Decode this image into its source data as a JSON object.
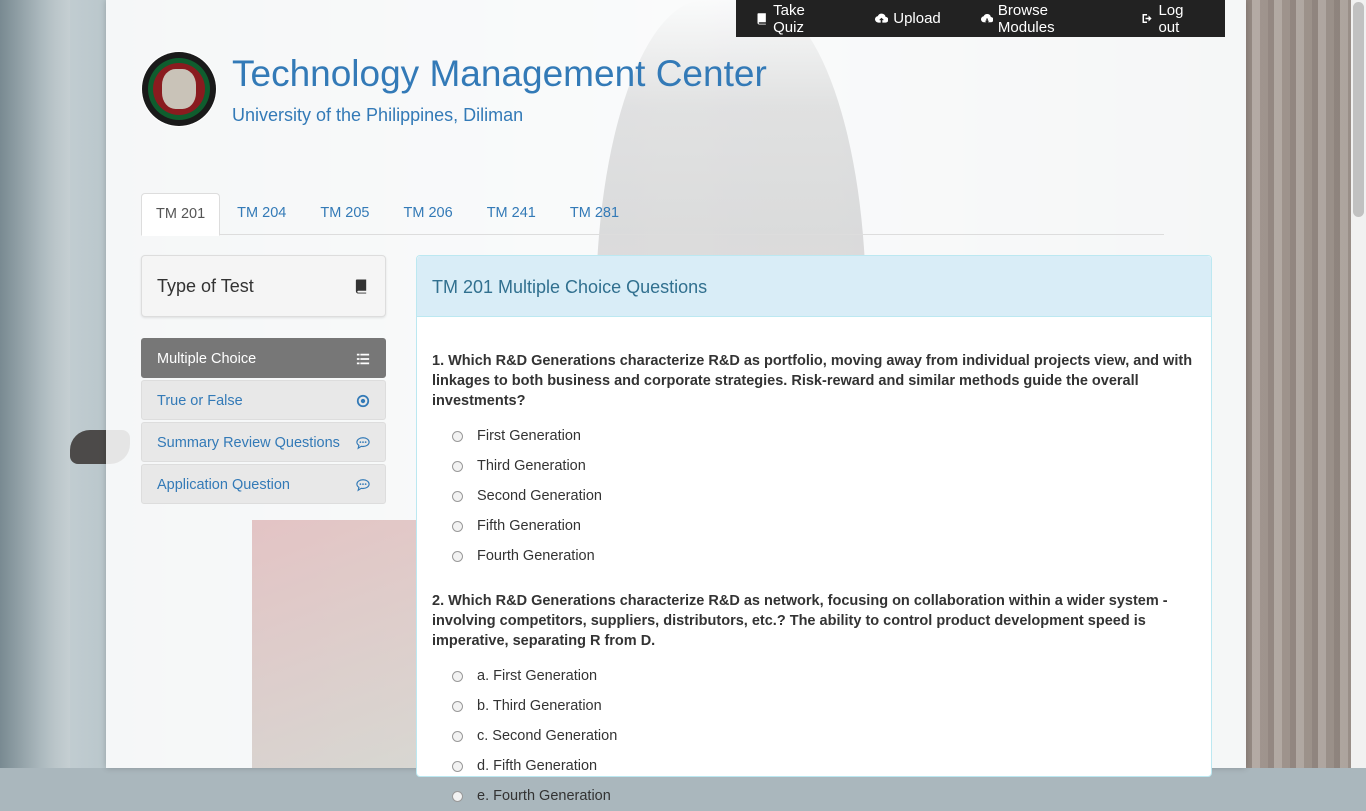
{
  "topnav": [
    {
      "label": "Take Quiz",
      "icon": "book-icon"
    },
    {
      "label": "Upload",
      "icon": "cloud-upload-icon"
    },
    {
      "label": "Browse Modules",
      "icon": "cloud-download-icon"
    },
    {
      "label": "Log out",
      "icon": "logout-icon"
    }
  ],
  "header": {
    "title": "Technology Management Center",
    "subtitle": "University of the Philippines, Diliman",
    "logo_icon": "tmc-seal-logo"
  },
  "tabs": [
    "TM 201",
    "TM 204",
    "TM 205",
    "TM 206",
    "TM 241",
    "TM 281"
  ],
  "active_tab": "TM 201",
  "sidebar": {
    "heading": "Type of Test",
    "heading_icon": "book-icon",
    "items": [
      {
        "label": "Multiple Choice",
        "icon": "list-icon",
        "active": true
      },
      {
        "label": "True or False",
        "icon": "radio-dot-icon"
      },
      {
        "label": "Summary Review Questions",
        "icon": "comment-icon"
      },
      {
        "label": "Application Question",
        "icon": "comment-icon"
      }
    ]
  },
  "panel": {
    "title": "TM 201 Multiple Choice Questions",
    "questions": [
      {
        "text": "1. Which R&D Generations characterize R&D as portfolio, moving away from individual projects view, and with linkages to both business and corporate strategies. Risk-reward and similar methods guide the overall investments?",
        "options": [
          "First Generation",
          "Third Generation",
          "Second Generation",
          "Fifth Generation",
          "Fourth Generation"
        ]
      },
      {
        "text": "2. Which R&D Generations characterize R&D as network, focusing on collaboration within a wider system - involving competitors, suppliers, distributors, etc.? The ability to control product development speed is imperative, separating R from D.",
        "options": [
          "a. First Generation",
          "b. Third Generation",
          "c. Second Generation",
          "d. Fifth Generation",
          "e. Fourth Generation"
        ]
      }
    ]
  },
  "colors": {
    "link": "#337ab7",
    "navbar": "#222222",
    "panel_heading_bg": "#d9edf7",
    "panel_heading_text": "#31708f",
    "active_menu": "#777777"
  }
}
